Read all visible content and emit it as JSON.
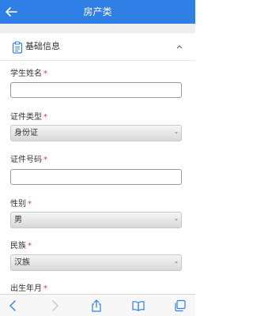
{
  "header": {
    "title": "房产类",
    "accent": "#2f7fe6"
  },
  "section": {
    "title": "基础信息"
  },
  "form": {
    "required_mark": "*",
    "student_name_label": "学生姓名",
    "id_type_label": "证件类型",
    "id_type_value": "身份证",
    "id_number_label": "证件号码",
    "gender_label": "性别",
    "gender_value": "男",
    "ethnicity_label": "民族",
    "ethnicity_value": "汉族",
    "birthdate_label": "出生年月"
  },
  "toolbar": {
    "icons": [
      "back-icon",
      "forward-icon",
      "share-icon",
      "bookmarks-icon",
      "tabs-icon"
    ]
  }
}
